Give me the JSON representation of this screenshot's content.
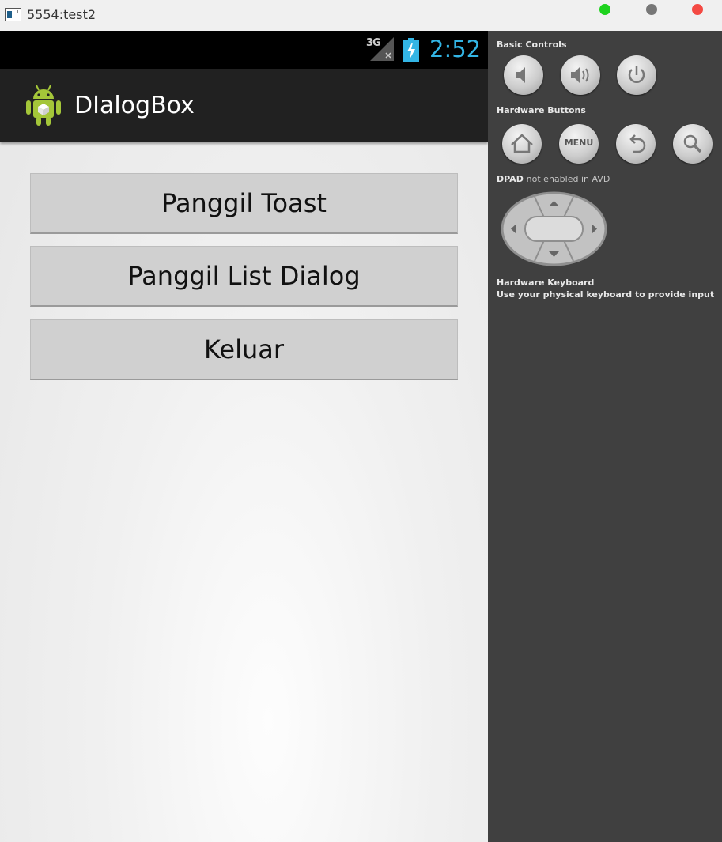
{
  "window": {
    "title": "5554:test2"
  },
  "status_bar": {
    "network": "3G",
    "time": "2:52"
  },
  "action_bar": {
    "title": "DIalogBox"
  },
  "buttons": [
    {
      "label": "Panggil Toast"
    },
    {
      "label": "Panggil List Dialog"
    },
    {
      "label": "Keluar"
    }
  ],
  "controls": {
    "basic_label": "Basic Controls",
    "hardware_label": "Hardware Buttons",
    "menu_button": "MENU",
    "dpad_label_bold": "DPAD",
    "dpad_label_rest": "not enabled in AVD",
    "keyboard_label": "Hardware Keyboard",
    "keyboard_hint": "Use your physical keyboard to provide input"
  },
  "colors": {
    "clock": "#33b5e5",
    "android_green": "#a4c639",
    "action_bar": "#212121",
    "panel": "#404040"
  },
  "icons": [
    "volume-down-icon",
    "volume-up-icon",
    "power-icon",
    "home-icon",
    "back-icon",
    "search-icon",
    "android-logo-icon"
  ]
}
